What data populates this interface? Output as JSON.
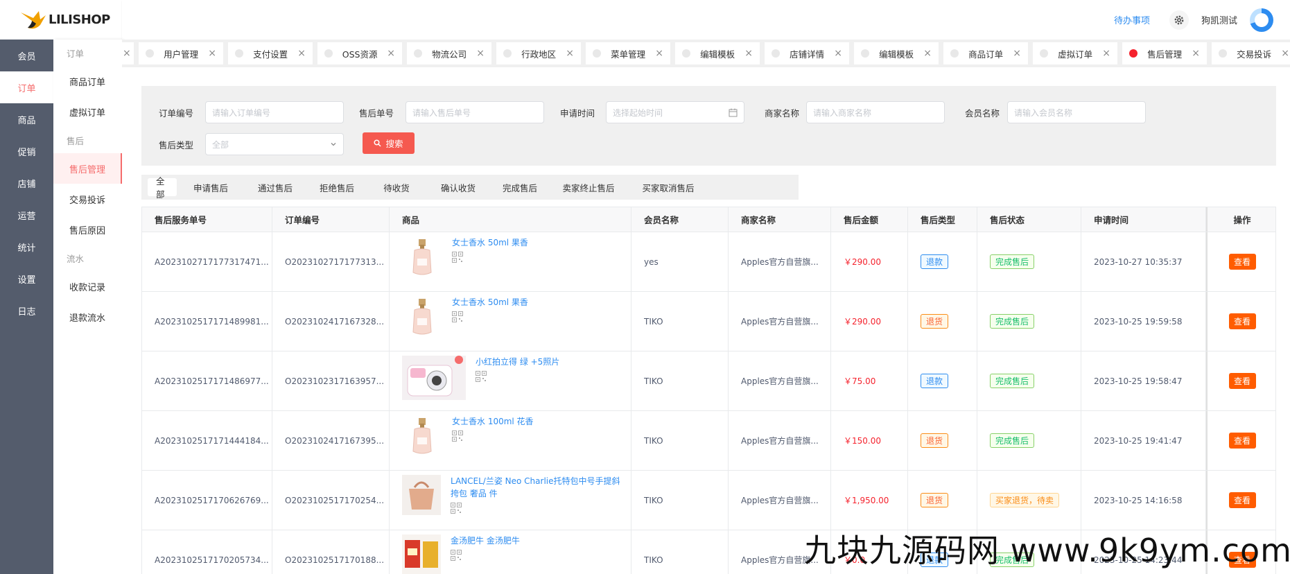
{
  "brand": {
    "name": "LILISHOP"
  },
  "header": {
    "todo": "待办事项",
    "user": "狗凯测试"
  },
  "nav_main": [
    "会员",
    "订单",
    "商品",
    "促销",
    "店铺",
    "运营",
    "统计",
    "设置",
    "日志"
  ],
  "nav_main_active": 1,
  "nav_sub": [
    {
      "type": "group",
      "label": "订单"
    },
    {
      "type": "item",
      "label": "商品订单"
    },
    {
      "type": "item",
      "label": "虚拟订单"
    },
    {
      "type": "group",
      "label": "售后"
    },
    {
      "type": "item",
      "label": "售后管理",
      "active": true
    },
    {
      "type": "item",
      "label": "交易投诉"
    },
    {
      "type": "item",
      "label": "售后原因"
    },
    {
      "type": "group",
      "label": "流水"
    },
    {
      "type": "item",
      "label": "收款记录"
    },
    {
      "type": "item",
      "label": "退款流水"
    }
  ],
  "tabs": [
    {
      "label": "用户管理"
    },
    {
      "label": "支付设置"
    },
    {
      "label": "OSS资源"
    },
    {
      "label": "物流公司"
    },
    {
      "label": "行政地区"
    },
    {
      "label": "菜单管理"
    },
    {
      "label": "编辑模板"
    },
    {
      "label": "店铺详情"
    },
    {
      "label": "编辑模板"
    },
    {
      "label": "商品订单"
    },
    {
      "label": "虚拟订单"
    },
    {
      "label": "售后管理",
      "active": true
    },
    {
      "label": "交易投诉"
    }
  ],
  "search": {
    "order_no": {
      "label": "订单编号",
      "placeholder": "请输入订单编号"
    },
    "service_no": {
      "label": "售后单号",
      "placeholder": "请输入售后单号"
    },
    "apply_time": {
      "label": "申请时间",
      "placeholder": "选择起始时间"
    },
    "store": {
      "label": "商家名称",
      "placeholder": "请输入商家名称"
    },
    "member": {
      "label": "会员名称",
      "placeholder": "请输入会员名称"
    },
    "type": {
      "label": "售后类型",
      "value": "全部"
    },
    "button": "搜索"
  },
  "status_tabs": [
    "全部",
    "申请售后",
    "通过售后",
    "拒绝售后",
    "待收货",
    "确认收货",
    "完成售后",
    "卖家终止售后",
    "买家取消售后"
  ],
  "status_active": 0,
  "table": {
    "headers": [
      "售后服务单号",
      "订单编号",
      "商品",
      "会员名称",
      "商家名称",
      "售后金额",
      "售后类型",
      "售后状态",
      "申请时间",
      "操作"
    ],
    "rows": [
      {
        "sn": "A2023102717177317471...",
        "order": "O2023102717177313...",
        "goods": "女士香水 50ml 果香",
        "img": "perfume",
        "member": "yes",
        "store": "Apples官方自营旗...",
        "amount": "￥290.00",
        "type": "退款",
        "type_color": "blue",
        "status": "完成售后",
        "status_color": "green",
        "time": "2023-10-27 10:35:37",
        "action": "查看"
      },
      {
        "sn": "A2023102517171489981...",
        "order": "O2023102417167328...",
        "goods": "女士香水 50ml 果香",
        "img": "perfume",
        "member": "TIKO",
        "store": "Apples官方自营旗...",
        "amount": "￥290.00",
        "type": "退货",
        "type_color": "orange",
        "status": "完成售后",
        "status_color": "green",
        "time": "2023-10-25 19:59:58",
        "action": "查看"
      },
      {
        "sn": "A2023102517171486977...",
        "order": "O2023102317163957...",
        "goods": "小红拍立得 绿 +5照片",
        "img": "camera",
        "member": "TIKO",
        "store": "Apples官方自营旗...",
        "amount": "￥75.00",
        "type": "退款",
        "type_color": "blue",
        "status": "完成售后",
        "status_color": "green",
        "time": "2023-10-25 19:58:47",
        "action": "查看"
      },
      {
        "sn": "A2023102517171444184...",
        "order": "O2023102417167395...",
        "goods": "女士香水 100ml 花香",
        "img": "perfume",
        "member": "TIKO",
        "store": "Apples官方自营旗...",
        "amount": "￥150.00",
        "type": "退货",
        "type_color": "orange",
        "status": "完成售后",
        "status_color": "green",
        "time": "2023-10-25 19:41:47",
        "action": "查看"
      },
      {
        "sn": "A2023102517170626769...",
        "order": "O2023102517170254...",
        "goods": "LANCEL/兰姿 Neo Charlie托特包中号手提斜挎包 奢品 件",
        "img": "bag",
        "member": "TIKO",
        "store": "Apples官方自营旗...",
        "amount": "￥1,950.00",
        "type": "退货",
        "type_color": "orange",
        "status": "买家退货，待卖",
        "status_color": "gold",
        "time": "2023-10-25 14:16:58",
        "action": "查看"
      },
      {
        "sn": "A2023102517170205734...",
        "order": "O2023102517170188...",
        "goods": "金汤肥牛 金汤肥牛",
        "img": "food",
        "member": "TIKO",
        "store": "Apples官方自营旗...",
        "amount": "￥0.0",
        "type": "退款",
        "type_color": "blue",
        "status": "完成售后",
        "status_color": "green",
        "time": "2023-10-25 14:23:44",
        "action": "查看"
      }
    ]
  },
  "watermark": "九块九源码网 www.9k9ym.com",
  "colors": {
    "accent": "#f56c6c",
    "primary": "#2d8cf0",
    "sidebar": "#545c6c",
    "action": "#ff5c00"
  }
}
